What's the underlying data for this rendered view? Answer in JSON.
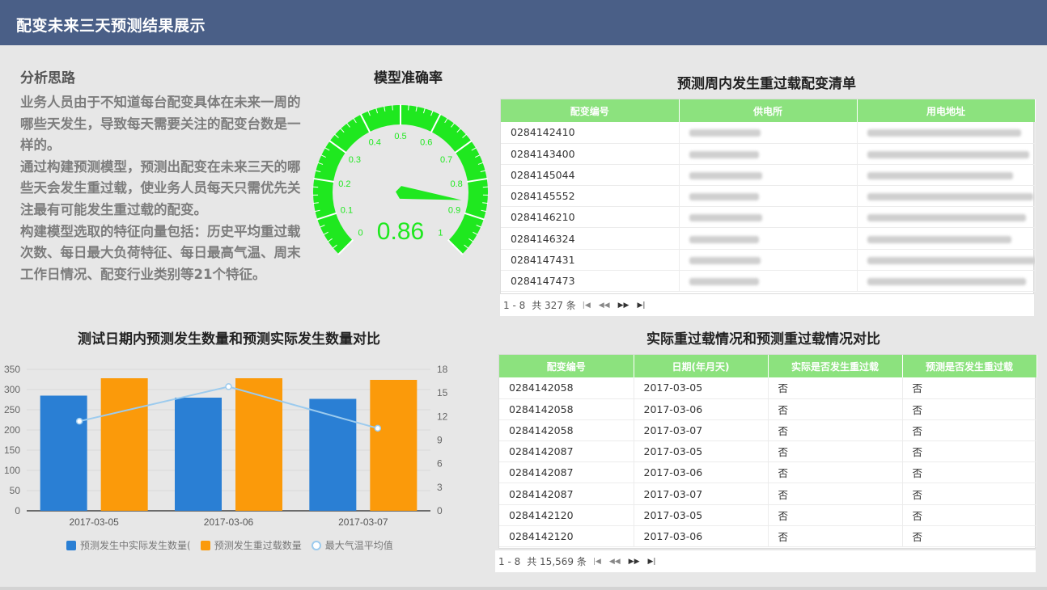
{
  "header": {
    "title": "配变未来三天预测结果展示"
  },
  "analysis": {
    "title": "分析思路",
    "paragraphs": [
      "业务人员由于不知道每台配变具体在未来一周的哪些天发生，导致每天需要关注的配变台数是一样的。",
      "通过构建预测模型，预测出配变在未来三天的哪些天会发生重过载，使业务人员每天只需优先关注最有可能发生重过载的配变。",
      "构建模型选取的特征向量包括：历史平均重过载次数、每日最大负荷特征、每日最高气温、周末工作日情况、配变行业类别等21个特征。"
    ]
  },
  "gauge": {
    "title": "模型准确率",
    "value": 0.86,
    "value_label": "0.86",
    "min": 0,
    "max": 1,
    "ticks": [
      "0",
      "0.1",
      "0.2",
      "0.3",
      "0.4",
      "0.5",
      "0.6",
      "0.7",
      "0.8",
      "0.9",
      "1"
    ],
    "color": "#1fe81f"
  },
  "list_table": {
    "title": "预测周内发生重过载配变清单",
    "columns": [
      "配变编号",
      "供电所",
      "用电地址"
    ],
    "rows": [
      [
        "0284142410"
      ],
      [
        "0284143400"
      ],
      [
        "0284145044"
      ],
      [
        "0284145552"
      ],
      [
        "0284146210"
      ],
      [
        "0284146324"
      ],
      [
        "0284147431"
      ],
      [
        "0284147473"
      ]
    ],
    "pager": {
      "range": "1 - 8",
      "total": "共 327 条"
    }
  },
  "compare_table": {
    "title": "实际重过载情况和预测重过载情况对比",
    "columns": [
      "配变编号",
      "日期(年月天)",
      "实际是否发生重过载",
      "预测是否发生重过载"
    ],
    "rows": [
      [
        "0284142058",
        "2017-03-05",
        "否",
        "否"
      ],
      [
        "0284142058",
        "2017-03-06",
        "否",
        "否"
      ],
      [
        "0284142058",
        "2017-03-07",
        "否",
        "否"
      ],
      [
        "0284142087",
        "2017-03-05",
        "否",
        "否"
      ],
      [
        "0284142087",
        "2017-03-06",
        "否",
        "否"
      ],
      [
        "0284142087",
        "2017-03-07",
        "否",
        "否"
      ],
      [
        "0284142120",
        "2017-03-05",
        "否",
        "否"
      ],
      [
        "0284142120",
        "2017-03-06",
        "否",
        "否"
      ]
    ],
    "pager": {
      "range": "1 - 8",
      "total": "共 15,569 条"
    }
  },
  "chart_data": {
    "type": "bar",
    "title": "测试日期内预测发生数量和预测实际发生数量对比",
    "categories": [
      "2017-03-05",
      "2017-03-06",
      "2017-03-07"
    ],
    "series": [
      {
        "name": "预测发生中实际发生数量(",
        "kind": "bar",
        "color": "#2a7fd4",
        "values": [
          285,
          280,
          277
        ]
      },
      {
        "name": "预测发生重过载数量",
        "kind": "bar",
        "color": "#fb9a0a",
        "values": [
          328,
          328,
          324
        ]
      },
      {
        "name": "最大气温平均值",
        "kind": "line",
        "axis": "right",
        "color": "#9ccbee",
        "values": [
          11.4,
          15.8,
          10.5
        ]
      }
    ],
    "ylim": [
      0,
      350
    ],
    "yticks": [
      "0",
      "50",
      "100",
      "150",
      "200",
      "250",
      "300",
      "350"
    ],
    "ylim_right": [
      0,
      18
    ],
    "yticks_right": [
      "0",
      "3",
      "6",
      "9",
      "12",
      "15",
      "18"
    ],
    "legend_position": "bottom"
  }
}
